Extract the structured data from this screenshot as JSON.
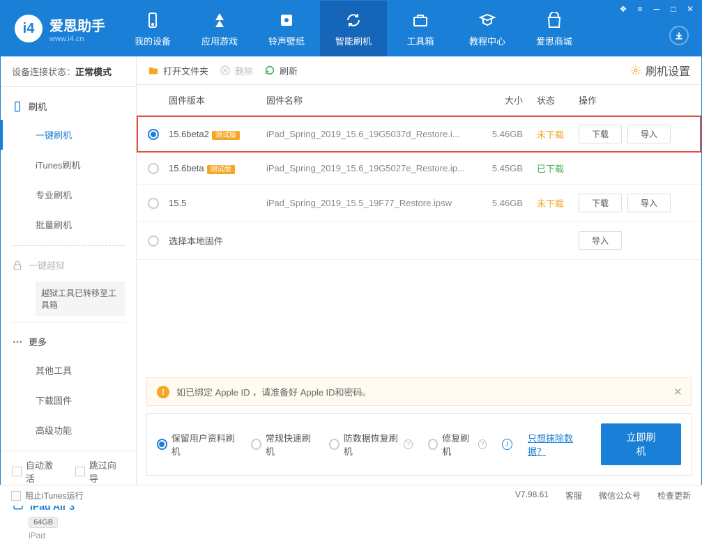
{
  "app": {
    "title": "爱思助手",
    "url": "www.i4.cn"
  },
  "nav": {
    "tabs": [
      {
        "label": "我的设备",
        "icon": "device"
      },
      {
        "label": "应用游戏",
        "icon": "apps"
      },
      {
        "label": "铃声壁纸",
        "icon": "music"
      },
      {
        "label": "智能刷机",
        "icon": "flash",
        "active": true
      },
      {
        "label": "工具箱",
        "icon": "toolbox"
      },
      {
        "label": "教程中心",
        "icon": "tutorial"
      },
      {
        "label": "爱思商城",
        "icon": "store"
      }
    ]
  },
  "sidebar": {
    "device_status_label": "设备连接状态：",
    "device_status_value": "正常模式",
    "flash_section": "刷机",
    "items": [
      {
        "label": "一键刷机",
        "active": true
      },
      {
        "label": "iTunes刷机"
      },
      {
        "label": "专业刷机"
      },
      {
        "label": "批量刷机"
      }
    ],
    "jailbreak_section": "一键越狱",
    "jailbreak_note": "越狱工具已转移至工具箱",
    "more_section": "更多",
    "more_items": [
      {
        "label": "其他工具"
      },
      {
        "label": "下载固件"
      },
      {
        "label": "高级功能"
      }
    ],
    "auto_activate": "自动激活",
    "skip_guide": "跳过向导",
    "device": {
      "name": "iPad Air 3",
      "storage": "64GB",
      "type": "iPad"
    }
  },
  "toolbar": {
    "open_folder": "打开文件夹",
    "delete": "删除",
    "refresh": "刷新",
    "settings": "刷机设置"
  },
  "table": {
    "headers": {
      "version": "固件版本",
      "name": "固件名称",
      "size": "大小",
      "status": "状态",
      "action": "操作"
    },
    "action_download": "下载",
    "action_import": "导入",
    "rows": [
      {
        "selected": true,
        "highlighted": true,
        "version": "15.6beta2",
        "beta": "测试版",
        "name": "iPad_Spring_2019_15.6_19G5037d_Restore.i...",
        "size": "5.46GB",
        "status": "未下载",
        "status_class": "not-downloaded",
        "show_download": true,
        "show_import": true
      },
      {
        "selected": false,
        "version": "15.6beta",
        "beta": "测试版",
        "name": "iPad_Spring_2019_15.6_19G5027e_Restore.ip...",
        "size": "5.45GB",
        "status": "已下载",
        "status_class": "downloaded",
        "show_download": false,
        "show_import": false
      },
      {
        "selected": false,
        "version": "15.5",
        "name": "iPad_Spring_2019_15.5_19F77_Restore.ipsw",
        "size": "5.46GB",
        "status": "未下载",
        "status_class": "not-downloaded",
        "show_download": true,
        "show_import": true
      },
      {
        "selected": false,
        "version": "选择本地固件",
        "local": true,
        "show_import": true
      }
    ]
  },
  "notice": {
    "text": "如已绑定 Apple ID ，请准备好 Apple ID和密码。"
  },
  "flash_options": {
    "options": [
      {
        "label": "保留用户资料刷机",
        "selected": true
      },
      {
        "label": "常规快速刷机"
      },
      {
        "label": "防数据恢复刷机",
        "help": true
      },
      {
        "label": "修复刷机",
        "help": true
      }
    ],
    "erase_link": "只想抹除数据？",
    "flash_btn": "立即刷机"
  },
  "footer": {
    "block_itunes": "阻止iTunes运行",
    "version": "V7.98.61",
    "support": "客服",
    "wechat": "微信公众号",
    "check_update": "检查更新"
  }
}
